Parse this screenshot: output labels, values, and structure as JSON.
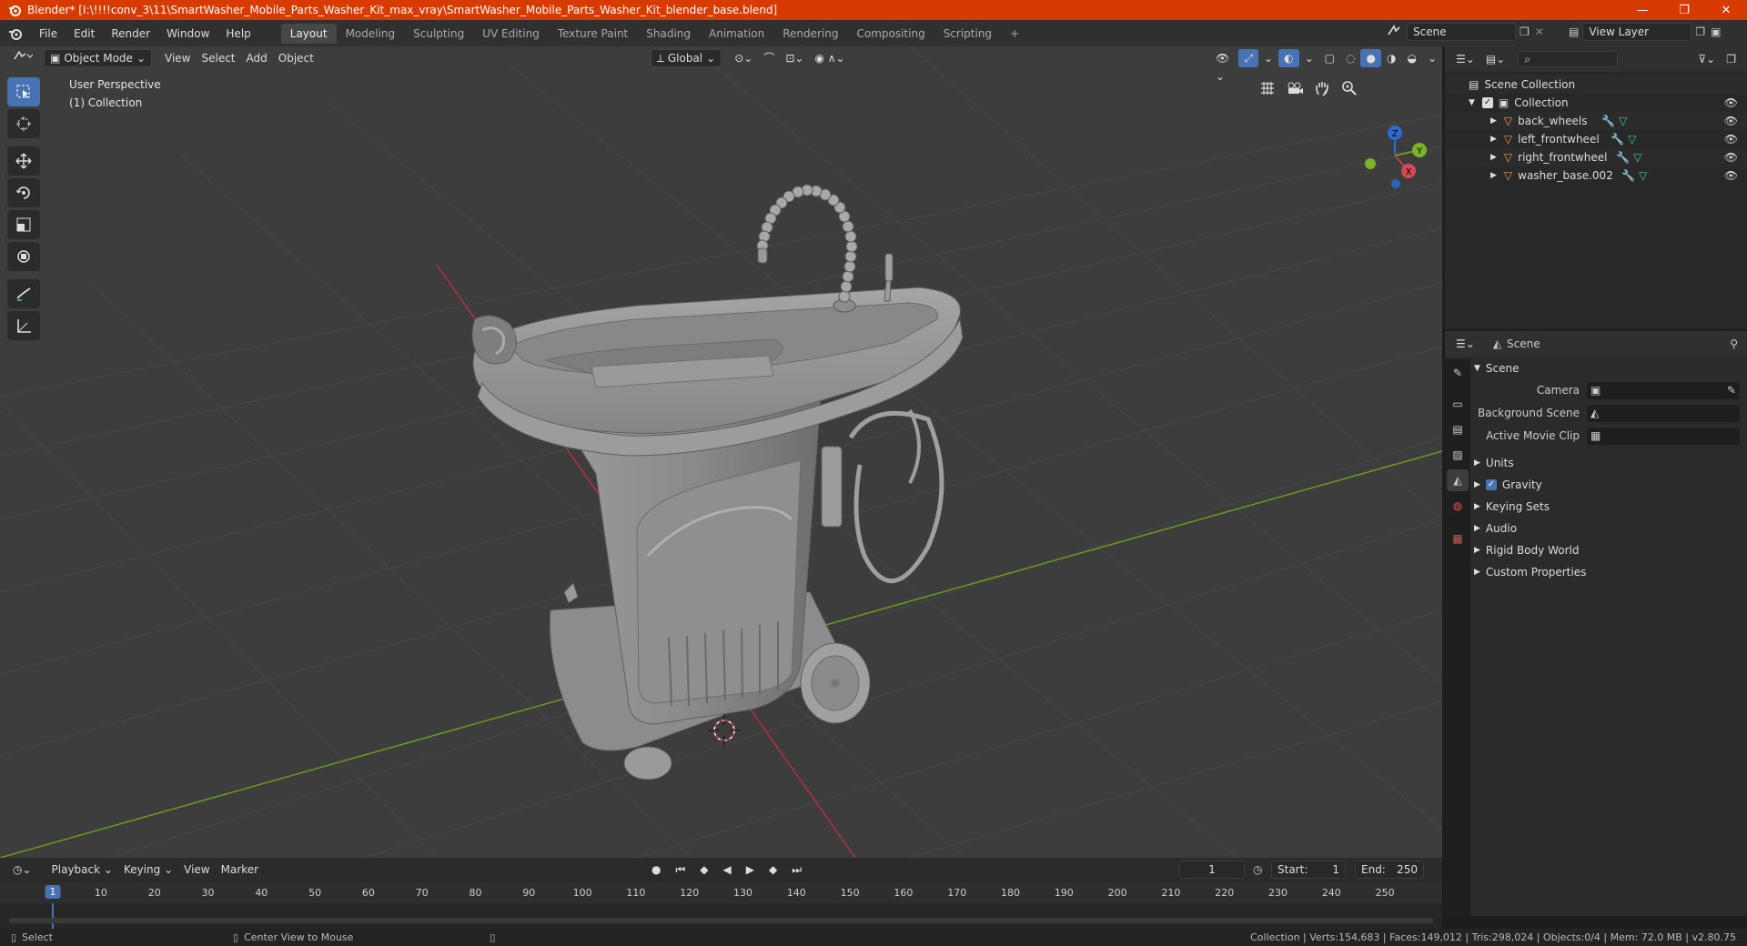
{
  "window": {
    "title": "Blender* [I:\\!!!!conv_3\\11\\SmartWasher_Mobile_Parts_Washer_Kit_max_vray\\SmartWasher_Mobile_Parts_Washer_Kit_blender_base.blend]",
    "minimize": "—",
    "maximize": "❐",
    "close": "✕"
  },
  "menu": {
    "items": [
      "File",
      "Edit",
      "Render",
      "Window",
      "Help"
    ],
    "workspaces": [
      "Layout",
      "Modeling",
      "Sculpting",
      "UV Editing",
      "Texture Paint",
      "Shading",
      "Animation",
      "Rendering",
      "Compositing",
      "Scripting"
    ],
    "add_tab": "+",
    "scene_name": "Scene",
    "view_layer": "View Layer"
  },
  "viewport": {
    "mode": "Object Mode",
    "menus": [
      "View",
      "Select",
      "Add",
      "Object"
    ],
    "transform_orientation": "Global",
    "info_line1": "User Perspective",
    "info_line2": "(1) Collection",
    "gizmo": {
      "x": "X",
      "y": "Y",
      "z": "Z"
    }
  },
  "outliner": {
    "root": "Scene Collection",
    "collection": "Collection",
    "objects": [
      {
        "name": "back_wheels"
      },
      {
        "name": "left_frontwheel"
      },
      {
        "name": "right_frontwheel"
      },
      {
        "name": "washer_base.002"
      }
    ]
  },
  "properties": {
    "context": "Scene",
    "section": "Scene",
    "rows": [
      {
        "label": "Camera"
      },
      {
        "label": "Background Scene"
      },
      {
        "label": "Active Movie Clip"
      }
    ],
    "collapsed": [
      "Units",
      "Gravity",
      "Keying Sets",
      "Audio",
      "Rigid Body World",
      "Custom Properties"
    ],
    "gravity_checked": true
  },
  "timeline": {
    "menus": [
      "Playback",
      "Keying",
      "View",
      "Marker"
    ],
    "current_frame": "1",
    "start_label": "Start:",
    "start": "1",
    "end_label": "End:",
    "end": "250",
    "ruler": [
      "1",
      "10",
      "20",
      "30",
      "40",
      "50",
      "60",
      "70",
      "80",
      "90",
      "100",
      "110",
      "120",
      "130",
      "140",
      "150",
      "160",
      "170",
      "180",
      "190",
      "200",
      "210",
      "220",
      "230",
      "240",
      "250"
    ]
  },
  "statusbar": {
    "left": "Select",
    "middle": "Center View to Mouse",
    "right": "Collection | Verts:154,683 | Faces:149,012 | Tris:298,024 | Objects:0/4 | Mem: 72.0 MB | v2.80.75"
  },
  "colors": {
    "titlebar": "#d83b01",
    "accent": "#4772b3",
    "viewport_bg": "#3d3d3d",
    "x_axis": "#b5323f",
    "y_axis": "#6a9b1f"
  }
}
